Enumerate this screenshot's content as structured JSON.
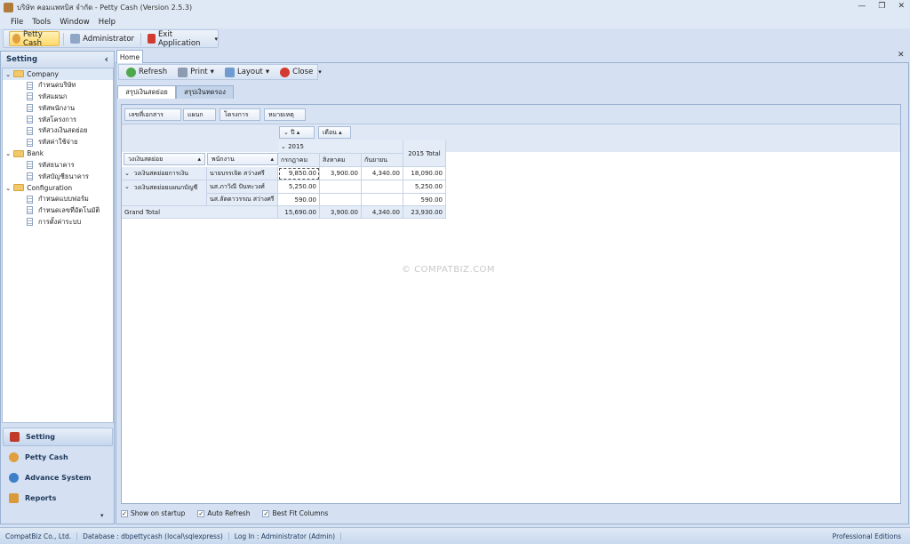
{
  "window": {
    "title": "บริษัท คอมแพทบิส จำกัด - Petty Cash (Version 2.5.3)",
    "minimize": "—",
    "restore": "❐",
    "close": "✕"
  },
  "menu": [
    "File",
    "Tools",
    "Window",
    "Help"
  ],
  "toolbar": {
    "petty_cash": "Petty Cash",
    "administrator": "Administrator",
    "exit": "Exit Application"
  },
  "sidebar": {
    "title": "Setting",
    "collapse": "‹",
    "groups": [
      {
        "label": "Company",
        "items": [
          "กำหนดบริษัท",
          "รหัสแผนก",
          "รหัสพนักงาน",
          "รหัสโครงการ",
          "รหัสวงเงินสดย่อย",
          "รหัสค่าใช้จ่าย"
        ]
      },
      {
        "label": "Bank",
        "items": [
          "รหัสธนาคาร",
          "รหัสบัญชีธนาคาร"
        ]
      },
      {
        "label": "Configuration",
        "items": [
          "กำหนดแบบฟอร์ม",
          "กำหนดเลขที่อัตโนมัติ",
          "การตั้งค่าระบบ"
        ]
      }
    ],
    "nav": [
      "Setting",
      "Petty Cash",
      "Advance System",
      "Reports"
    ]
  },
  "doc_tab": "Home",
  "inner_toolbar": {
    "refresh": "Refresh",
    "print": "Print",
    "layout": "Layout",
    "close": "Close"
  },
  "subtabs": [
    "สรุปเงินสดย่อย",
    "สรุปเงินทดรอง"
  ],
  "pivot": {
    "filter_fields": [
      "เลขที่เอกสาร",
      "แผนก",
      "โครงการ",
      "หมายเหตุ"
    ],
    "column_fields": [
      "ปี",
      "เดือน"
    ],
    "row_fields": [
      "วงเงินสดย่อย",
      "พนักงาน"
    ],
    "year": "2015",
    "year_total": "2015 Total",
    "months": [
      "กรกฎาคม",
      "สิงหาคม",
      "กันยายน"
    ],
    "rows": [
      {
        "group": "วงเงินสดย่อยการเงิน",
        "employee": "นายบรรเจิด สว่างศรี",
        "values": [
          "9,850.00",
          "3,900.00",
          "4,340.00"
        ],
        "total": "18,090.00"
      },
      {
        "group": "วงเงินสดย่อยแผนกบัญชี",
        "employee": "นส.ภาวิณี ปันทะวงศ์",
        "values": [
          "5,250.00",
          "",
          ""
        ],
        "total": "5,250.00"
      },
      {
        "group": "",
        "employee": "นส.ลัดดาวรรณ สว่างศรี",
        "values": [
          "590.00",
          "",
          ""
        ],
        "total": "590.00"
      }
    ],
    "grand_total": {
      "label": "Grand Total",
      "values": [
        "15,690.00",
        "3,900.00",
        "4,340.00"
      ],
      "total": "23,930.00"
    }
  },
  "watermark": "© COMPATBIZ.COM",
  "options": [
    "Show on startup",
    "Auto Refresh",
    "Best Fit Columns"
  ],
  "status": {
    "company": "CompatBiz Co., Ltd.",
    "database": "Database : dbpettycash (local\\sqlexpress)",
    "login": "Log In : Administrator (Admin)",
    "edition": "Professional Editions"
  }
}
